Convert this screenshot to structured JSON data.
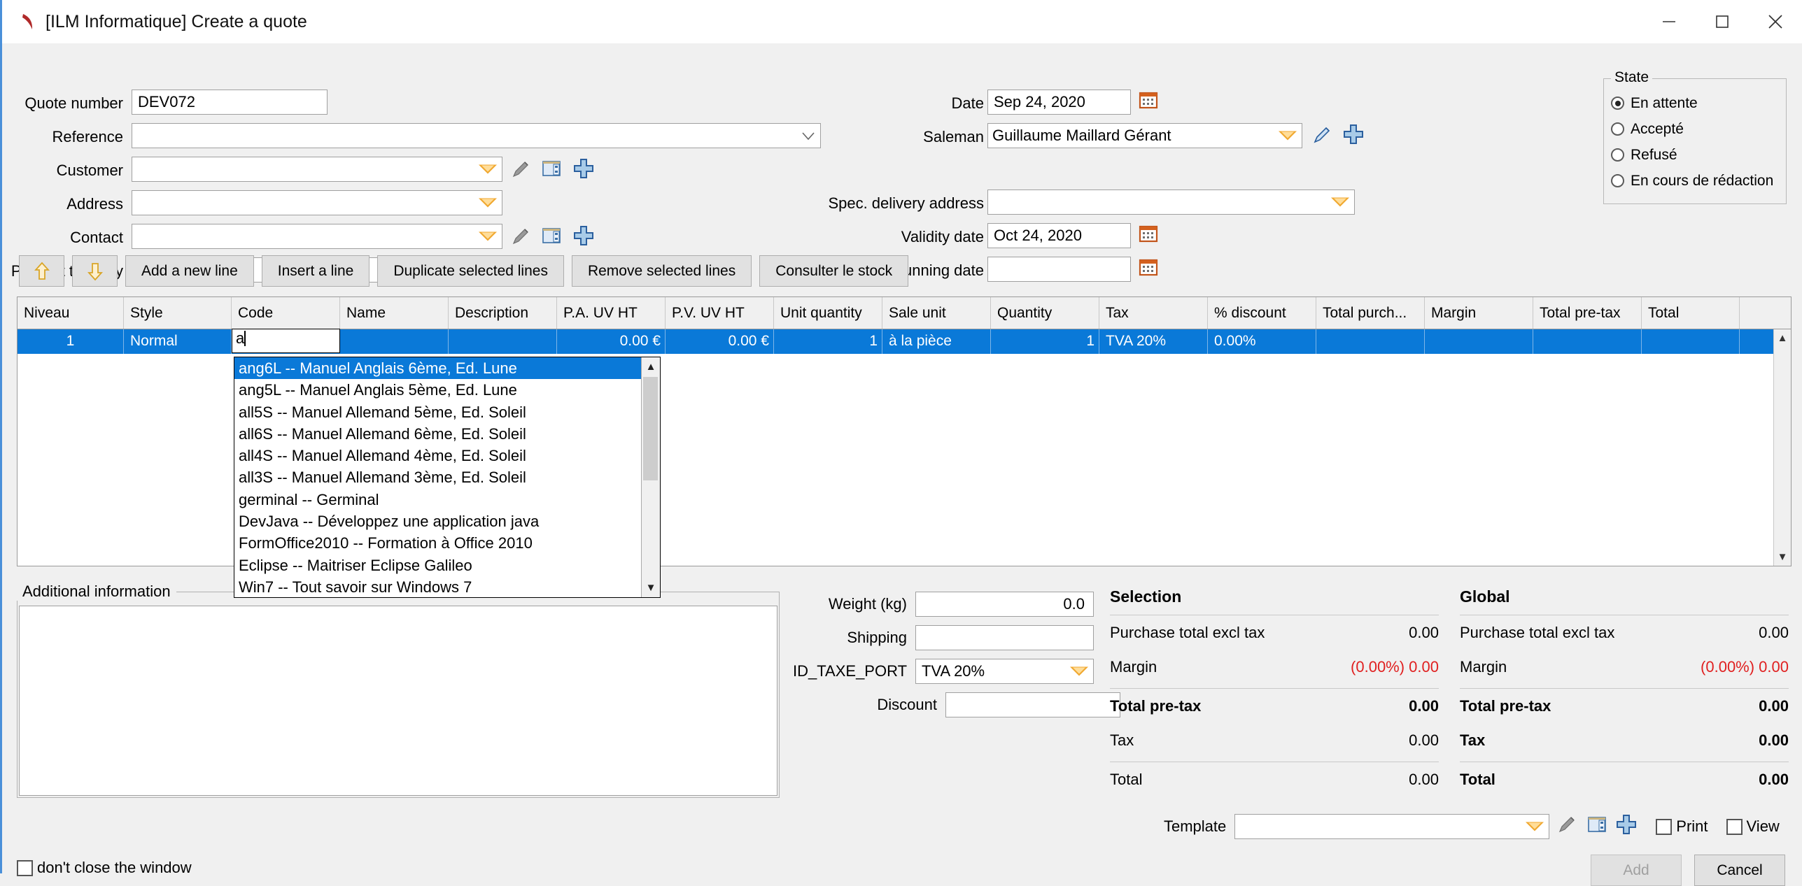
{
  "window": {
    "title": "[ILM Informatique] Create a quote",
    "app_icon": "ilm-logo-icon",
    "minimize": "minimize-icon",
    "maximize": "maximize-icon",
    "close": "close-icon"
  },
  "form_left": {
    "quote_number": {
      "label": "Quote number",
      "value": "DEV072"
    },
    "reference": {
      "label": "Reference",
      "value": ""
    },
    "customer": {
      "label": "Customer",
      "value": ""
    },
    "address": {
      "label": "Address",
      "value": ""
    },
    "contact": {
      "label": "Contact",
      "value": ""
    },
    "pricelist": {
      "label": "Pricelist to apply",
      "value": ""
    }
  },
  "form_right": {
    "date": {
      "label": "Date",
      "value": "Sep 24, 2020"
    },
    "saleman": {
      "label": "Saleman",
      "value": "Guillaume Maillard Gérant"
    },
    "spec_delivery": {
      "label": "Spec. delivery address",
      "value": ""
    },
    "validity_date": {
      "label": "Validity date",
      "value": "Oct 24, 2020"
    },
    "dunning_date": {
      "label": "Dunning date",
      "value": ""
    }
  },
  "state": {
    "legend": "State",
    "options": [
      {
        "label": "En attente",
        "selected": true
      },
      {
        "label": "Accepté",
        "selected": false
      },
      {
        "label": "Refusé",
        "selected": false
      },
      {
        "label": "En cours de rédaction",
        "selected": false
      }
    ]
  },
  "toolbar": {
    "move_up": "↑",
    "move_down": "↓",
    "add_new_line": "Add a new line",
    "insert_a_line": "Insert a line",
    "duplicate_selected_lines": "Duplicate selected lines",
    "remove_selected_lines": "Remove selected lines",
    "consulter_le_stock": "Consulter le stock"
  },
  "grid": {
    "columns": [
      "Niveau",
      "Style",
      "Code",
      "Name",
      "Description",
      "P.A. UV HT",
      "P.V. UV HT",
      "Unit quantity",
      "Sale unit",
      "Quantity",
      "Tax",
      "% discount",
      "Total purch...",
      "Margin",
      "Total pre-tax",
      "Total"
    ],
    "rows": [
      {
        "niveau": "1",
        "style": "Normal",
        "code": "a",
        "name": "",
        "description": "",
        "pa_uv_ht": "0.00 €",
        "pv_uv_ht": "0.00 €",
        "unit_quantity": "1",
        "sale_unit": "à la pièce",
        "quantity": "1",
        "tax": "TVA 20%",
        "discount": "0.00%",
        "total_purchase": "",
        "margin": "",
        "total_pretax": "",
        "total": ""
      }
    ]
  },
  "code_dropdown": {
    "items": [
      {
        "label": "ang6L -- Manuel Anglais 6ème, Ed. Lune",
        "selected": true
      },
      {
        "label": "ang5L -- Manuel Anglais 5ème, Ed. Lune",
        "selected": false
      },
      {
        "label": "all5S -- Manuel Allemand 5ème, Ed. Soleil",
        "selected": false
      },
      {
        "label": "all6S -- Manuel Allemand 6ème, Ed. Soleil",
        "selected": false
      },
      {
        "label": "all4S -- Manuel Allemand 4ème, Ed. Soleil",
        "selected": false
      },
      {
        "label": "all3S -- Manuel Allemand 3ème, Ed. Soleil",
        "selected": false
      },
      {
        "label": "germinal -- Germinal",
        "selected": false
      },
      {
        "label": "DevJava -- Développez une application java",
        "selected": false
      },
      {
        "label": "FormOffice2010 -- Formation à Office 2010",
        "selected": false
      },
      {
        "label": "Eclipse -- Maitriser Eclipse Galileo",
        "selected": false
      },
      {
        "label": "Win7 -- Tout savoir sur Windows 7",
        "selected": false
      }
    ]
  },
  "additional_information": {
    "legend": "Additional information",
    "value": ""
  },
  "mid_fields": {
    "weight": {
      "label": "Weight (kg)",
      "value": "0.0"
    },
    "shipping": {
      "label": "Shipping",
      "value": ""
    },
    "id_taxe_port": {
      "label": "ID_TAXE_PORT",
      "value": "TVA 20%"
    },
    "discount": {
      "label": "Discount",
      "value": ""
    }
  },
  "totals": {
    "selection": {
      "title": "Selection",
      "rows": [
        {
          "label": "Purchase total excl tax",
          "value": "0.00",
          "bold": false,
          "red": false
        },
        {
          "label": "Margin",
          "value": "(0.00%) 0.00",
          "bold": false,
          "red": true
        },
        {
          "label": "Total pre-tax",
          "value": "0.00",
          "bold": true,
          "red": false
        },
        {
          "label": "Tax",
          "value": "0.00",
          "bold": false,
          "red": false
        },
        {
          "label": "Total",
          "value": "0.00",
          "bold": false,
          "red": false
        }
      ]
    },
    "global": {
      "title": "Global",
      "rows": [
        {
          "label": "Purchase total excl tax",
          "value": "0.00",
          "bold": false,
          "red": false
        },
        {
          "label": "Margin",
          "value": "(0.00%) 0.00",
          "bold": false,
          "red": true
        },
        {
          "label": "Total pre-tax",
          "value": "0.00",
          "bold": true,
          "red": false
        },
        {
          "label": "Tax",
          "value": "0.00",
          "bold": true,
          "red": false
        },
        {
          "label": "Total",
          "value": "0.00",
          "bold": true,
          "red": false
        }
      ]
    }
  },
  "template_row": {
    "label": "Template",
    "value": "",
    "print_label": "Print",
    "view_label": "View"
  },
  "footer": {
    "dont_close_label": "don't close the window",
    "add_label": "Add",
    "cancel_label": "Cancel"
  },
  "colors": {
    "selection_blue": "#0a79d8",
    "accent_orange": "#f0a830",
    "window_bg": "#f0f0f0",
    "red": "#e02020"
  }
}
